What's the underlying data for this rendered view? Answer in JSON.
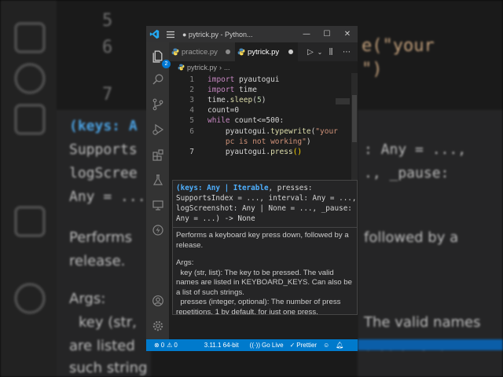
{
  "background": {
    "line_numbers": [
      "5",
      "6",
      "7"
    ],
    "code_fragment_1": "e(\"your",
    "code_fragment_2": "\")",
    "hover_left_sig": [
      "(keys: A",
      "Supports",
      "logScree",
      "Any = ..."
    ],
    "hover_right_sig": [
      ": Any = ...,",
      "., _pause:"
    ],
    "hover_left_doc": [
      "Performs",
      "release.",
      "Args:",
      "key (str,",
      "are listed",
      "such string"
    ],
    "hover_right_doc": [
      "followed by a",
      "The valid names",
      "o be a list of"
    ]
  },
  "window": {
    "title": "● pytrick.py - Python...",
    "controls": [
      "—",
      "☐",
      "✕"
    ],
    "notification_count": "2"
  },
  "tabs": [
    {
      "label": "practice.py",
      "active": false,
      "unsaved": true
    },
    {
      "label": "pytrick.py",
      "active": true,
      "unsaved": true
    }
  ],
  "tab_actions": [
    "▷",
    "⌄",
    "⫼",
    "⋯"
  ],
  "breadcrumb": {
    "file": "pytrick.py",
    "rest": "..."
  },
  "editor": {
    "lines": [
      {
        "n": "1",
        "tokens": [
          [
            "kw",
            "import"
          ],
          [
            "pl",
            " pyautogui"
          ]
        ]
      },
      {
        "n": "2",
        "tokens": [
          [
            "kw",
            "import"
          ],
          [
            "pl",
            " time"
          ]
        ]
      },
      {
        "n": "3",
        "tokens": [
          [
            "pl",
            "time."
          ],
          [
            "fn",
            "sleep"
          ],
          [
            "pl",
            "("
          ],
          [
            "num",
            "5"
          ],
          [
            "pl",
            ")"
          ]
        ]
      },
      {
        "n": "4",
        "tokens": [
          [
            "pl",
            "count=0"
          ]
        ]
      },
      {
        "n": "5",
        "tokens": [
          [
            "kw",
            "while"
          ],
          [
            "pl",
            " count<=500:"
          ]
        ]
      },
      {
        "n": "6",
        "tokens": [
          [
            "pl",
            "    pyautogui."
          ],
          [
            "fn",
            "typewrite"
          ],
          [
            "pl",
            "("
          ],
          [
            "str",
            "\"your"
          ]
        ]
      },
      {
        "n": "",
        "tokens": [
          [
            "str",
            "    pc is not working\""
          ],
          [
            "pl",
            ")"
          ]
        ]
      },
      {
        "n": "7",
        "tokens": [
          [
            "pl",
            "    pyautogui."
          ],
          [
            "fn",
            "press"
          ],
          [
            "br",
            "()"
          ]
        ]
      }
    ]
  },
  "hover": {
    "signature": [
      [
        [
          "p",
          "(keys: Any | Iterable"
        ],
        [
          "t",
          ", presses:"
        ]
      ],
      [
        [
          "t",
          "SupportsIndex = ..., interval: Any = ...,"
        ]
      ],
      [
        [
          "t",
          "logScreenshot: Any | None = ..., _pause:"
        ]
      ],
      [
        [
          "t",
          "Any = ...) -> None"
        ]
      ]
    ],
    "doc": [
      "Performs a keyboard key press down, followed by a release.",
      "Args:\n  key (str, list): The key to be pressed. The valid names are listed in KEYBOARD_KEYS. Can also be a list of such strings.\n  presses (integer, optional): The number of press repetitions. 1 by default, for just one press."
    ]
  },
  "statusbar": {
    "errors": "0",
    "warnings": "0",
    "python": "3.11.1 64-bit",
    "golive": "Go Live",
    "prettier": "Prettier"
  },
  "colors": {
    "statusbar": "#007acc",
    "editor_bg": "#1e1e1e",
    "activity_bg": "#333333",
    "badge": "#0078d4"
  }
}
